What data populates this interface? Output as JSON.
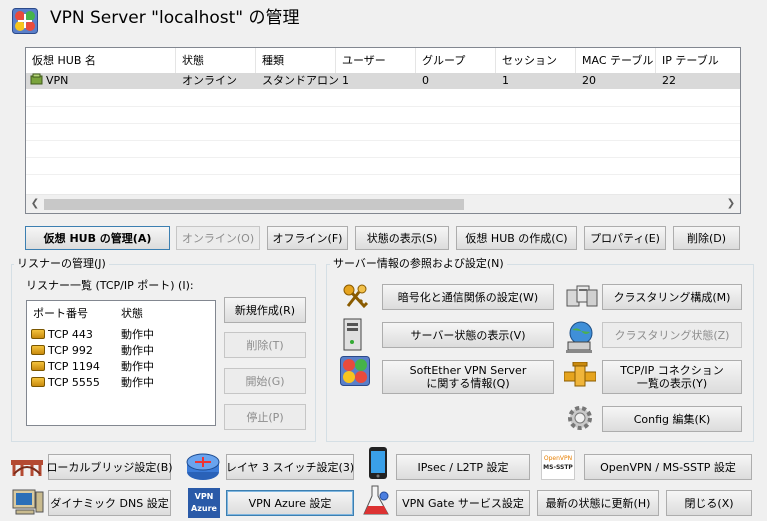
{
  "window": {
    "title": "VPN Server \"localhost\" の管理"
  },
  "hub_table": {
    "columns": [
      "仮想 HUB 名",
      "状態",
      "種類",
      "ユーザー",
      "グループ",
      "セッション",
      "MAC テーブル",
      "IP テーブル"
    ],
    "rows": [
      [
        "VPN",
        "オンライン",
        "スタンドアロン",
        "1",
        "0",
        "1",
        "20",
        "22"
      ]
    ]
  },
  "hub_buttons": {
    "manage": "仮想 HUB の管理(A)",
    "online": "オンライン(O)",
    "offline": "オフライン(F)",
    "status": "状態の表示(S)",
    "create": "仮想 HUB の作成(C)",
    "properties": "プロパティ(E)",
    "delete": "削除(D)"
  },
  "listener_group": {
    "label": "リスナーの管理(J)",
    "list_label": "リスナー一覧 (TCP/IP ポート) (I):",
    "columns": [
      "ポート番号",
      "状態"
    ],
    "rows": [
      [
        "TCP 443",
        "動作中"
      ],
      [
        "TCP 992",
        "動作中"
      ],
      [
        "TCP 1194",
        "動作中"
      ],
      [
        "TCP 5555",
        "動作中"
      ]
    ],
    "buttons": {
      "new": "新規作成(R)",
      "delete": "削除(T)",
      "start": "開始(G)",
      "stop": "停止(P)"
    }
  },
  "server_group": {
    "label": "サーバー情報の参照および設定(N)",
    "encryption": "暗号化と通信関係の設定(W)",
    "clustering_config": "クラスタリング構成(M)",
    "server_status": "サーバー状態の表示(V)",
    "clustering_status": "クラスタリング状態(Z)",
    "about_line1": "SoftEther VPN Server",
    "about_line2": "に関する情報(Q)",
    "tcpip_line1": "TCP/IP コネクション",
    "tcpip_line2": "一覧の表示(Y)",
    "config_edit": "Config 編集(K)"
  },
  "bottom_bar": {
    "local_bridge": "ローカルブリッジ設定(B)",
    "layer3": "レイヤ 3 スイッチ設定(3)",
    "ipsec": "IPsec / L2TP 設定",
    "openvpn": "OpenVPN / MS-SSTP 設定",
    "dynamic_dns": "ダイナミック DNS 設定",
    "vpn_azure": "VPN Azure 設定",
    "vpn_gate": "VPN Gate サービス設定",
    "refresh": "最新の状態に更新(H)",
    "close": "閉じる(X)",
    "openvpn_icon_text_1": "OpenVPN",
    "openvpn_icon_text_2": "MS-SSTP",
    "azure_icon_text_1": "VPN",
    "azure_icon_text_2": "Azure"
  },
  "icons": [
    "softether-logo-icon",
    "hub-icon",
    "keys-icon",
    "server-icon",
    "globe-laptop-icon",
    "softether-info-icon",
    "pipe-icon",
    "gear-icon",
    "bridge-icon",
    "router-icon",
    "phone-icon",
    "openvpn-icon",
    "computer-icon",
    "azure-icon",
    "flask-icon",
    "clustering-icon"
  ]
}
